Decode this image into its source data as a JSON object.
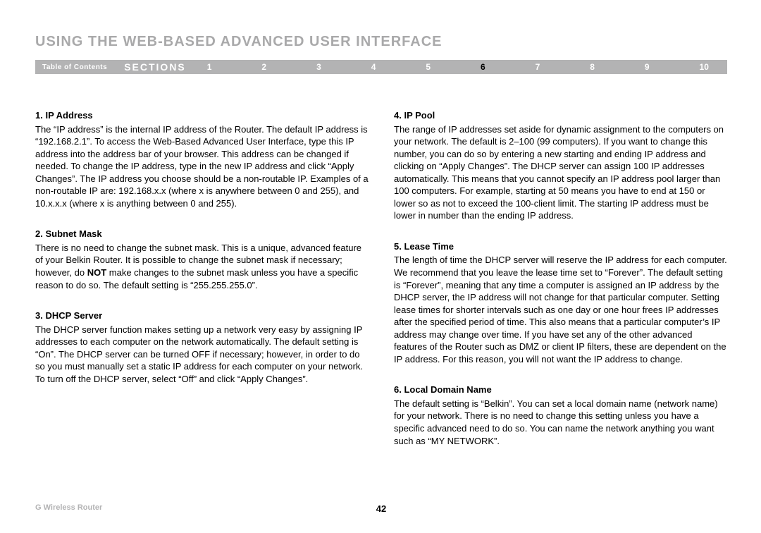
{
  "header": {
    "title": "USING THE WEB-BASED ADVANCED USER INTERFACE"
  },
  "nav": {
    "toc_label": "Table of Contents",
    "sections_label": "SECTIONS",
    "numbers": [
      "1",
      "2",
      "3",
      "4",
      "5",
      "6",
      "7",
      "8",
      "9",
      "10"
    ],
    "active_index": 5
  },
  "left": {
    "s1": {
      "heading": "1.    IP Address",
      "body": "The “IP address” is the internal IP address of the Router. The default IP address is “192.168.2.1”. To access the Web-Based Advanced User Interface, type this IP address into the address bar of your browser. This address can be changed if needed. To change the IP address, type in the new IP address and click “Apply Changes”. The IP address you choose should be a non-routable IP. Examples of a non-routable IP are: 192.168.x.x (where x is anywhere between 0 and 255), and 10.x.x.x (where x is anything between 0 and 255)."
    },
    "s2": {
      "heading": "2.    Subnet Mask",
      "body_a": "There is no need to change the subnet mask. This is a unique, advanced feature of your Belkin Router. It is possible to change the subnet mask if necessary; however, do ",
      "body_bold": "NOT",
      "body_b": " make changes to the subnet mask unless you have a specific reason to do so. The default setting is “255.255.255.0”."
    },
    "s3": {
      "heading": "3.    DHCP Server",
      "body": "The DHCP server function makes setting up a network very easy by assigning IP addresses to each computer on the network automatically. The default setting is “On”. The DHCP server can be turned OFF if necessary; however, in order to do so you must manually set a static IP address for each computer on your network. To turn off the DHCP server, select “Off” and click “Apply Changes”."
    }
  },
  "right": {
    "s4": {
      "heading": "4.    IP Pool",
      "body": "The range of IP addresses set aside for dynamic assignment to the computers on your network. The default is 2–100 (99 computers). If you want to change this number, you can do so by entering a new starting and ending IP address and clicking on “Apply Changes”. The DHCP server can assign 100 IP addresses automatically. This means that you cannot specify an IP address pool larger than 100 computers. For example, starting at 50 means you have to end at 150 or lower so as not to exceed the 100-client limit. The starting IP address must be lower in number than the ending IP address."
    },
    "s5": {
      "heading": "5.    Lease Time",
      "body": "The length of time the DHCP server will reserve the IP address for each computer. We recommend that you leave the lease time set to “Forever”. The default setting is “Forever”, meaning that any time a computer is assigned an IP address by the DHCP server, the IP address will not change for that particular computer. Setting lease times for shorter intervals such as one day or one hour frees IP addresses after the specified period of time. This also means that a particular computer’s IP address may change over time. If you have set any of the other advanced features of the Router such as DMZ or client IP filters, these are dependent on the IP address. For this reason, you will not want the IP address to change."
    },
    "s6": {
      "heading": "6.    Local Domain Name",
      "body": "The default setting is “Belkin”. You can set a local domain name (network name) for your network. There is no need to change this setting unless you have a specific advanced need to do so. You can name the network anything you want such as “MY NETWORK”."
    }
  },
  "footer": {
    "product": "G Wireless Router",
    "page_num": "42"
  }
}
